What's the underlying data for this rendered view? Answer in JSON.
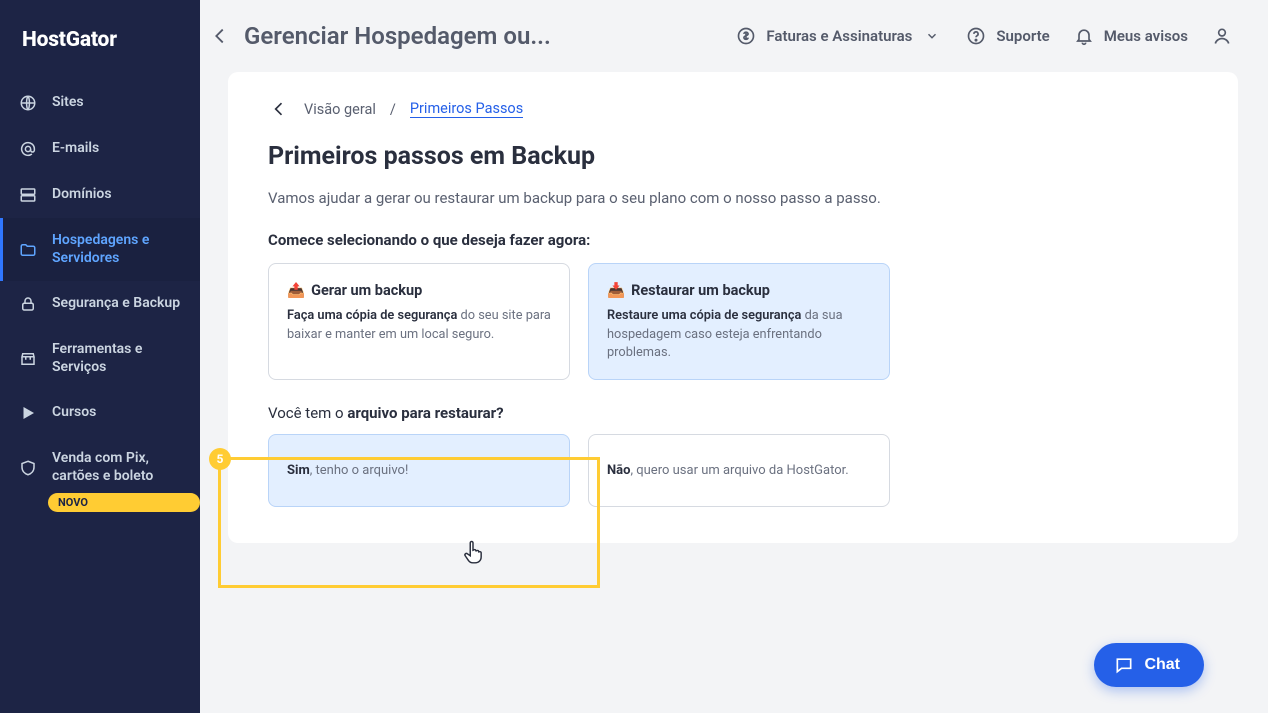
{
  "logo": "HostGator",
  "sidebar": {
    "items": [
      {
        "label": "Sites"
      },
      {
        "label": "E-mails"
      },
      {
        "label": "Domínios"
      },
      {
        "label": "Hospedagens e Servidores"
      },
      {
        "label": "Segurança e Backup"
      },
      {
        "label": "Ferramentas e Serviços"
      },
      {
        "label": "Cursos"
      },
      {
        "label": "Venda com Pix, cartões e boleto"
      }
    ],
    "badge": "NOVO"
  },
  "topbar": {
    "title": "Gerenciar Hospedagem ou...",
    "billing": "Faturas e Assinaturas",
    "support": "Suporte",
    "notices": "Meus avisos"
  },
  "breadcrumb": {
    "root": "Visão geral",
    "sep": "/",
    "current": "Primeiros Passos"
  },
  "page": {
    "title": "Primeiros passos em Backup",
    "subtitle": "Vamos ajudar a gerar ou restaurar um backup para o seu plano com o nosso passo a passo.",
    "section_head": "Comece selecionando o que deseja fazer agora:"
  },
  "options": {
    "generate": {
      "icon": "📤",
      "title": "Gerar um backup",
      "desc_bold": "Faça uma cópia de segurança",
      "desc_rest": " do seu site para baixar e manter em um local seguro."
    },
    "restore": {
      "icon": "📥",
      "title": "Restaurar um backup",
      "desc_bold": "Restaure uma cópia de segurança",
      "desc_rest": " da sua hospedagem caso esteja enfrentando problemas."
    }
  },
  "question": {
    "pre": "Você tem o ",
    "bold": "arquivo para restaurar?"
  },
  "answers": {
    "yes_bold": "Sim",
    "yes_rest": ", tenho o arquivo!",
    "no_bold": "Não",
    "no_rest": ", quero usar um arquivo da HostGator."
  },
  "highlight_num": "5",
  "chat_label": "Chat"
}
